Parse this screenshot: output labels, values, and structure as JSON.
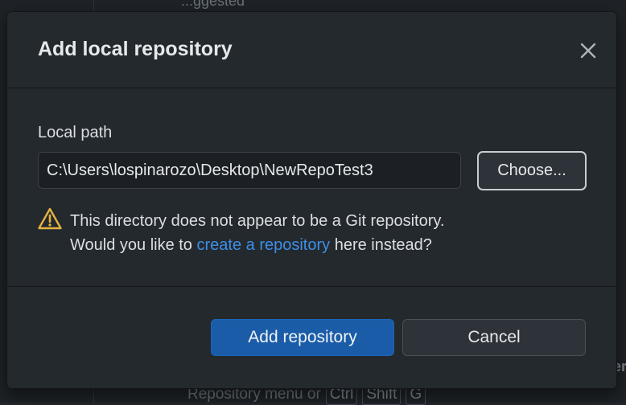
{
  "background": {
    "top_fragment": "...ggested",
    "hint_prefix": "Repository menu or",
    "hint_keys": [
      "Ctrl",
      "Shift",
      "G"
    ],
    "right_fragment": "er"
  },
  "dialog": {
    "title": "Add local repository",
    "close_icon": "close-icon",
    "local_path": {
      "label": "Local path",
      "value": "C:\\Users\\lospinarozo\\Desktop\\NewRepoTest3"
    },
    "choose_button": "Choose...",
    "warning": {
      "icon": "warning-icon",
      "line1": "This directory does not appear to be a Git repository.",
      "line2_prefix": "Would you like to ",
      "link_text": "create a repository",
      "line2_suffix": " here instead?"
    },
    "add_button": "Add repository",
    "cancel_button": "Cancel"
  },
  "colors": {
    "dialog_bg": "#24292e",
    "accent": "#1a5ca8",
    "link": "#3c8fe8",
    "warning": "#e3b341"
  }
}
